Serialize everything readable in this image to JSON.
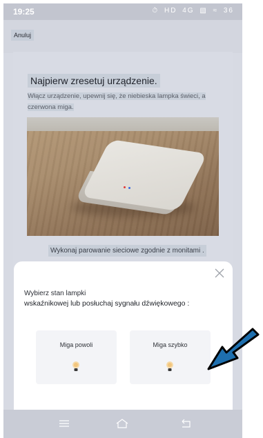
{
  "status_bar": {
    "time": "19:25",
    "icons": [
      "alarm-icon",
      "hd-icon",
      "4g-icon",
      "signal-icon",
      "wifi-icon",
      "battery-icon"
    ],
    "hd_text": "HD",
    "network_text": "4G",
    "battery_text": "36"
  },
  "top_bar": {
    "cancel_label": "Anuluj"
  },
  "reset_step": {
    "title": "Najpierw zresetuj urządzenie.",
    "description": "Włącz urządzenie, upewnij się, że niebieska lampka świeci, a czerwona miga."
  },
  "pairing_text": "Wykonaj parowanie sieciowe zgodnie z monitami .",
  "sheet": {
    "title_line1": "Wybierz stan lampki",
    "title_line2": "wskaźnikowej lub posłuchaj sygnału dźwiękowego :",
    "options": [
      {
        "label": "Miga powoli",
        "icon": "bulb-icon"
      },
      {
        "label": "Miga szybko",
        "icon": "bulb-icon"
      }
    ]
  },
  "colors": {
    "overlay_bg": "#d7dae3",
    "sheet_bg": "#ffffff",
    "option_bg": "#f3f4f7",
    "arrow_blue": "#1e6fae",
    "led_red": "#e03a3a",
    "led_blue": "#3a6be0"
  }
}
